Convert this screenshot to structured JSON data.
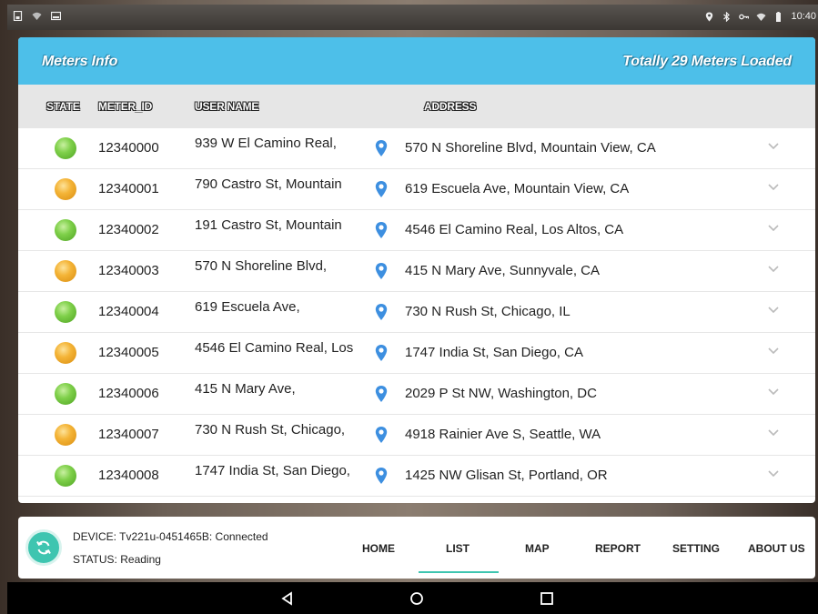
{
  "status_bar": {
    "time": "10:40",
    "left_icons": [
      "sim-icon",
      "wifi-icon",
      "screenshot-icon"
    ],
    "right_icons": [
      "location-icon",
      "bluetooth-icon",
      "vpn-key-icon",
      "signal-icon",
      "battery-icon"
    ]
  },
  "header": {
    "title": "Meters Info",
    "count_text": "Totally 29 Meters Loaded",
    "accent_color": "#4dbfe9"
  },
  "columns": {
    "state": "STATE",
    "meter_id": "METER_ID",
    "user_name": "USER NAME",
    "address": "ADDRESS"
  },
  "rows": [
    {
      "state": "green",
      "meter_id": "12340000",
      "user_name": "939 W El Camino Real,",
      "address": "570 N Shoreline Blvd, Mountain View, CA"
    },
    {
      "state": "orange",
      "meter_id": "12340001",
      "user_name": "790 Castro St, Mountain",
      "address": "619 Escuela Ave, Mountain View, CA"
    },
    {
      "state": "green",
      "meter_id": "12340002",
      "user_name": "191 Castro St, Mountain",
      "address": "4546 El Camino Real, Los Altos, CA"
    },
    {
      "state": "orange",
      "meter_id": "12340003",
      "user_name": "570 N Shoreline Blvd,",
      "address": "415 N Mary Ave, Sunnyvale, CA"
    },
    {
      "state": "green",
      "meter_id": "12340004",
      "user_name": "619 Escuela Ave,",
      "address": "730 N Rush St, Chicago, IL"
    },
    {
      "state": "orange",
      "meter_id": "12340005",
      "user_name": "4546 El Camino Real, Los",
      "address": "1747 India St, San Diego, CA"
    },
    {
      "state": "green",
      "meter_id": "12340006",
      "user_name": "415 N Mary Ave,",
      "address": "2029 P St NW, Washington, DC"
    },
    {
      "state": "orange",
      "meter_id": "12340007",
      "user_name": "730 N Rush St, Chicago,",
      "address": "4918 Rainier Ave S, Seattle, WA"
    },
    {
      "state": "green",
      "meter_id": "12340008",
      "user_name": "1747 India St, San Diego,",
      "address": "1425 NW Glisan St, Portland, OR"
    }
  ],
  "bottom": {
    "device_text": "DEVICE:  Tv221u-0451465B: Connected",
    "status_text": "STATUS: Reading",
    "nav": {
      "home": "HOME",
      "list": "LIST",
      "map": "MAP",
      "report": "REPORT",
      "setting": "SETTING",
      "about": "ABOUT US"
    },
    "active_tab": "LIST",
    "accent_color": "#3ec5b0"
  },
  "system_nav": [
    "back-icon",
    "home-icon",
    "recents-icon"
  ]
}
